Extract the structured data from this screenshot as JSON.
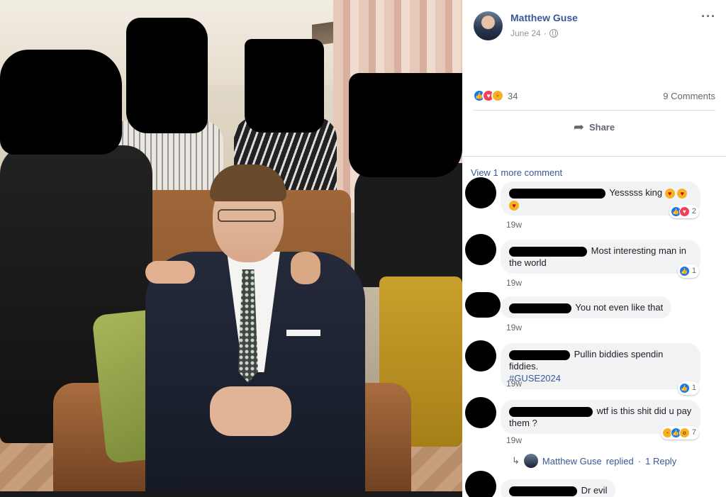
{
  "post": {
    "author": "Matthew Guse",
    "date": "June 24",
    "date_sep": "·",
    "more_icon": "ellipsis-icon",
    "privacy_icon": "globe-icon"
  },
  "stats": {
    "reaction_count": "34",
    "reaction_types": [
      "like",
      "love",
      "haha"
    ],
    "comments_label": "9 Comments"
  },
  "actions": {
    "share_label": "Share",
    "share_icon": "share-arrow-icon"
  },
  "comments_section": {
    "view_more": "View 1 more comment",
    "items": [
      {
        "text": "Yesssss king",
        "reaction_count": "2",
        "reactions": [
          "like",
          "love"
        ],
        "time": "19w"
      },
      {
        "text": "Most interesting man in the world",
        "reaction_count": "1",
        "reactions": [
          "like"
        ],
        "time": "19w"
      },
      {
        "text": "You not even like that",
        "time": "19w"
      },
      {
        "text": "Pullin biddies spendin fiddies.",
        "hashtag": "#GUSE2024",
        "reaction_count": "1",
        "reactions": [
          "like"
        ],
        "time": "19w"
      },
      {
        "text": "wtf is this shit did u pay them ?",
        "reaction_count": "7",
        "reactions": [
          "haha",
          "like",
          "wow"
        ],
        "time": "19w"
      },
      {
        "text": "Dr evil"
      }
    ],
    "reply": {
      "author": "Matthew Guse",
      "action": "replied",
      "sep": "·",
      "count_label": "1 Reply"
    }
  },
  "colors": {
    "link": "#385898",
    "muted": "#606770",
    "bubble": "#f2f3f5",
    "like": "#1877f2",
    "love": "#f33e58"
  }
}
